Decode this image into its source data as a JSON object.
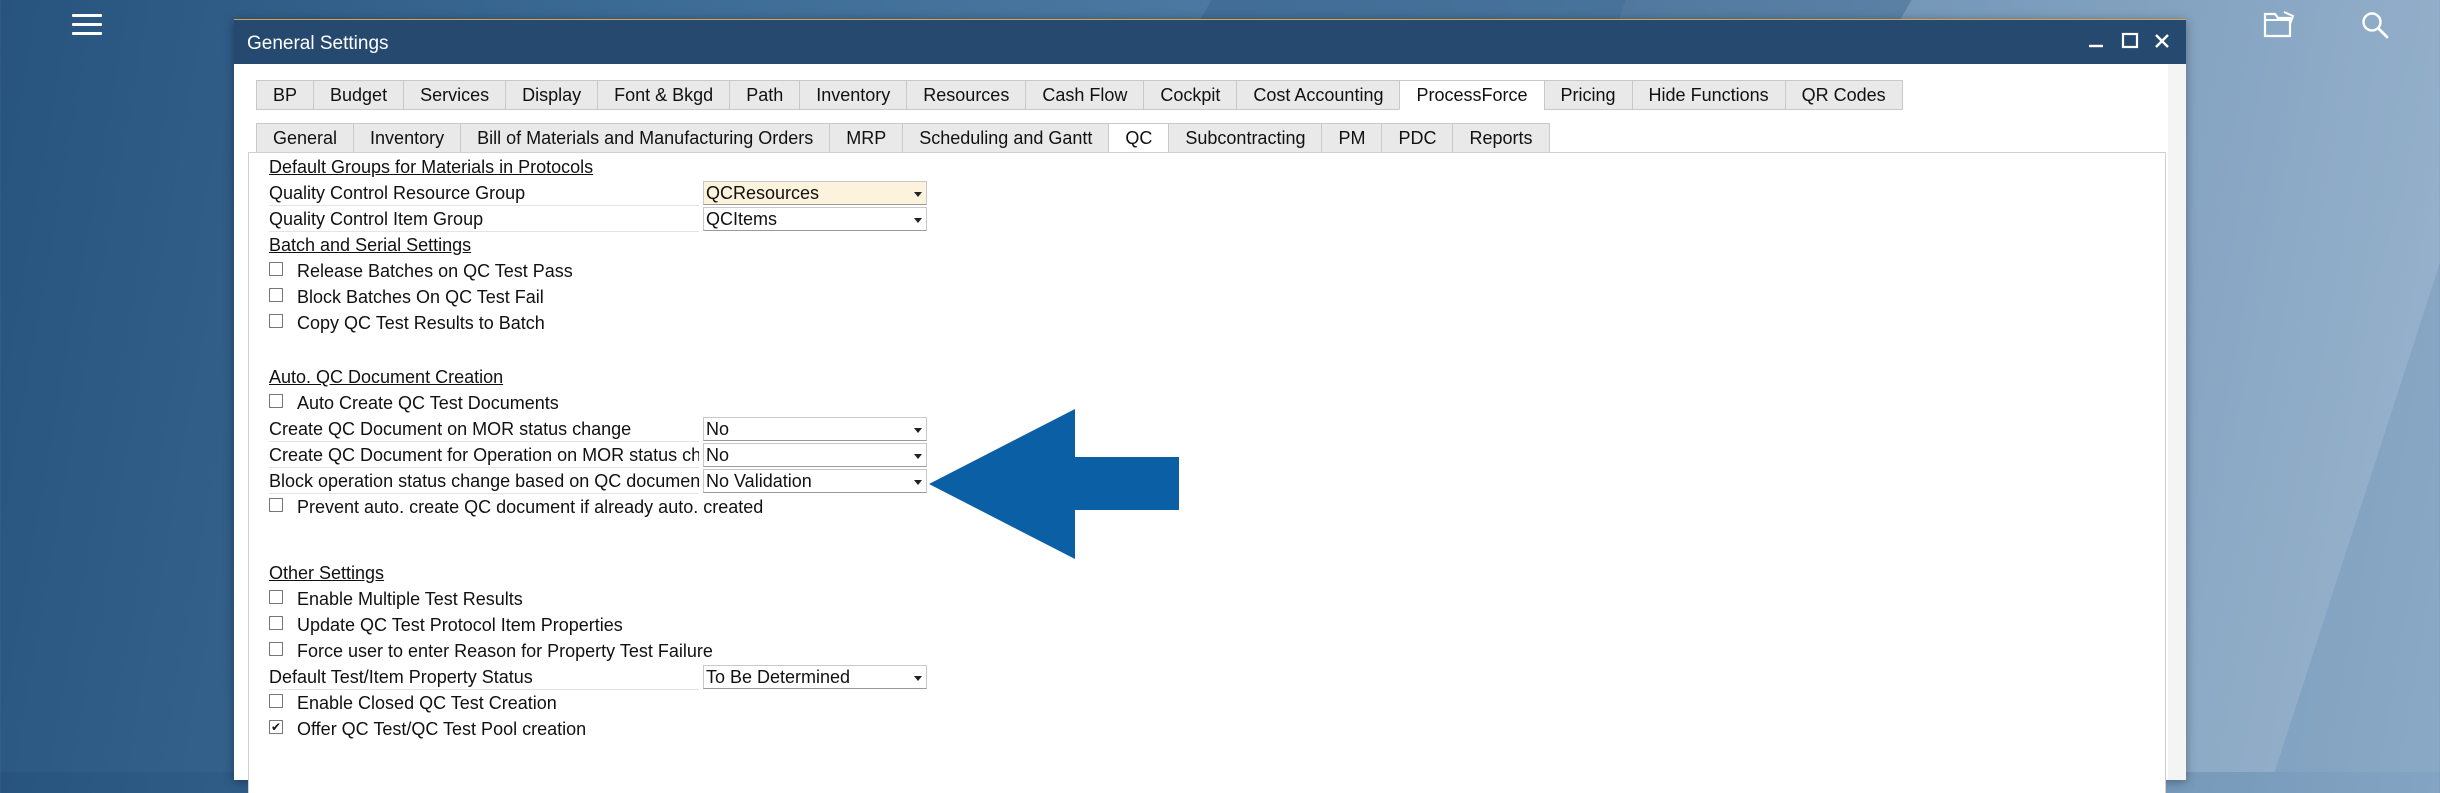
{
  "window": {
    "title": "General Settings"
  },
  "tabs_primary": [
    "BP",
    "Budget",
    "Services",
    "Display",
    "Font & Bkgd",
    "Path",
    "Inventory",
    "Resources",
    "Cash Flow",
    "Cockpit",
    "Cost Accounting",
    "ProcessForce",
    "Pricing",
    "Hide Functions",
    "QR Codes"
  ],
  "tabs_secondary": [
    "General",
    "Inventory",
    "Bill of Materials and Manufacturing Orders",
    "MRP",
    "Scheduling and Gantt",
    "QC",
    "Subcontracting",
    "PM",
    "PDC",
    "Reports"
  ],
  "active_primary": "ProcessForce",
  "active_secondary": "QC",
  "sections": {
    "default_groups": "Default Groups for Materials in Protocols",
    "batch_serial": "Batch and Serial Settings",
    "auto_qc": "Auto. QC Document Creation",
    "other": "Other Settings"
  },
  "fields": {
    "qc_resource_group": {
      "label": "Quality Control Resource Group",
      "value": "QCResources"
    },
    "qc_item_group": {
      "label": "Quality Control Item Group",
      "value": "QCItems"
    },
    "create_on_mor": {
      "label": "Create QC Document on MOR status change",
      "value": "No"
    },
    "create_for_operation": {
      "label": "Create QC Document for Operation on MOR status change",
      "value": "No"
    },
    "block_operation": {
      "label": "Block operation status change based on QC document",
      "value": "No Validation"
    },
    "default_property_status": {
      "label": "Default Test/Item Property Status",
      "value": "To Be Determined"
    }
  },
  "checkboxes": {
    "release_batches": {
      "label": "Release Batches on QC Test Pass",
      "checked": false
    },
    "block_batches": {
      "label": "Block Batches On QC Test Fail",
      "checked": false
    },
    "copy_results": {
      "label": "Copy QC Test Results to Batch",
      "checked": false
    },
    "auto_create": {
      "label": "Auto Create QC Test Documents",
      "checked": false
    },
    "prevent_auto": {
      "label": "Prevent auto. create QC document if already auto. created",
      "checked": false
    },
    "enable_multiple": {
      "label": "Enable Multiple Test Results",
      "checked": false
    },
    "update_protocol": {
      "label": "Update QC Test Protocol Item Properties",
      "checked": false
    },
    "force_reason": {
      "label": "Force user to enter Reason for Property Test Failure",
      "checked": false
    },
    "enable_closed": {
      "label": "Enable Closed QC Test Creation",
      "checked": false
    },
    "offer_pool": {
      "label": "Offer QC Test/QC Test Pool creation",
      "checked": true
    }
  },
  "colors": {
    "titlebar": "#26496f",
    "arrow": "#0b5fa5",
    "highlight_field": "#fdf3dc"
  },
  "icons": [
    "hamburger-menu-icon",
    "folder-icon",
    "search-icon",
    "minimize-icon",
    "maximize-icon",
    "close-icon",
    "dropdown-arrow-icon"
  ]
}
